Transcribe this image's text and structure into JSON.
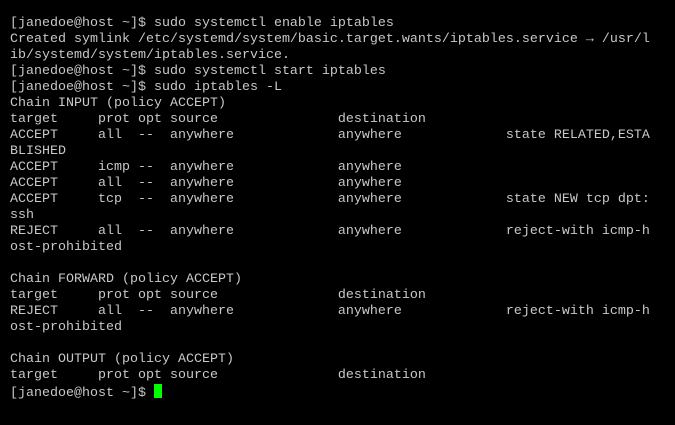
{
  "terminal": {
    "lines": [
      "[janedoe@host ~]$ sudo systemctl enable iptables",
      "Created symlink /etc/systemd/system/basic.target.wants/iptables.service → /usr/l",
      "ib/systemd/system/iptables.service.",
      "[janedoe@host ~]$ sudo systemctl start iptables",
      "[janedoe@host ~]$ sudo iptables -L",
      "Chain INPUT (policy ACCEPT)",
      "target     prot opt source               destination",
      "ACCEPT     all  --  anywhere             anywhere             state RELATED,ESTA",
      "BLISHED",
      "ACCEPT     icmp --  anywhere             anywhere",
      "ACCEPT     all  --  anywhere             anywhere",
      "ACCEPT     tcp  --  anywhere             anywhere             state NEW tcp dpt:",
      "ssh",
      "REJECT     all  --  anywhere             anywhere             reject-with icmp-h",
      "ost-prohibited",
      "",
      "Chain FORWARD (policy ACCEPT)",
      "target     prot opt source               destination",
      "REJECT     all  --  anywhere             anywhere             reject-with icmp-h",
      "ost-prohibited",
      "",
      "Chain OUTPUT (policy ACCEPT)",
      "target     prot opt source               destination",
      "[janedoe@host ~]$ "
    ],
    "colors": {
      "background": "#000000",
      "text": "#c8c8c8",
      "cursor": "#00ff00"
    }
  }
}
